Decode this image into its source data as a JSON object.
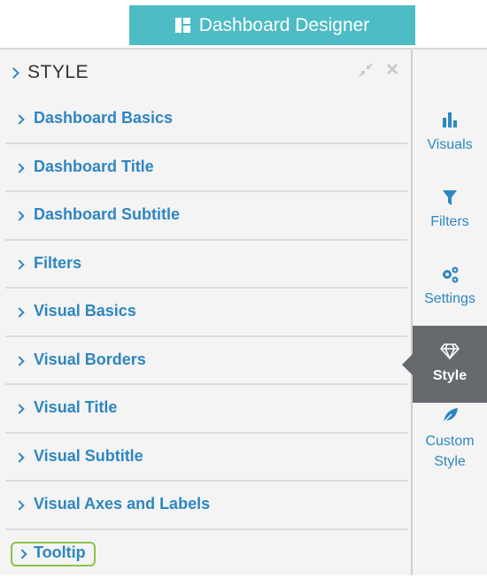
{
  "header": {
    "designer_label": "Dashboard Designer"
  },
  "panel": {
    "title": "STYLE",
    "sections": [
      {
        "label": "Dashboard Basics"
      },
      {
        "label": "Dashboard Title"
      },
      {
        "label": "Dashboard Subtitle"
      },
      {
        "label": "Filters"
      },
      {
        "label": "Visual Basics"
      },
      {
        "label": "Visual Borders"
      },
      {
        "label": "Visual Title"
      },
      {
        "label": "Visual Subtitle"
      },
      {
        "label": "Visual Axes and Labels"
      },
      {
        "label": "Tooltip"
      }
    ],
    "highlighted_section": "Tooltip"
  },
  "sidebar": {
    "items": [
      {
        "label": "Visuals",
        "icon": "bar-chart-icon"
      },
      {
        "label": "Filters",
        "icon": "funnel-icon"
      },
      {
        "label": "Settings",
        "icon": "gears-icon"
      },
      {
        "label": "Style",
        "icon": "diamond-icon",
        "active": true
      },
      {
        "label": "Custom Style",
        "label_line1": "Custom",
        "label_line2": "Style",
        "icon": "leaf-icon"
      }
    ]
  },
  "colors": {
    "accent": "#4dbcc4",
    "link": "#2e86c1",
    "active_tab": "#666a6e",
    "highlight": "#8bc34a"
  }
}
